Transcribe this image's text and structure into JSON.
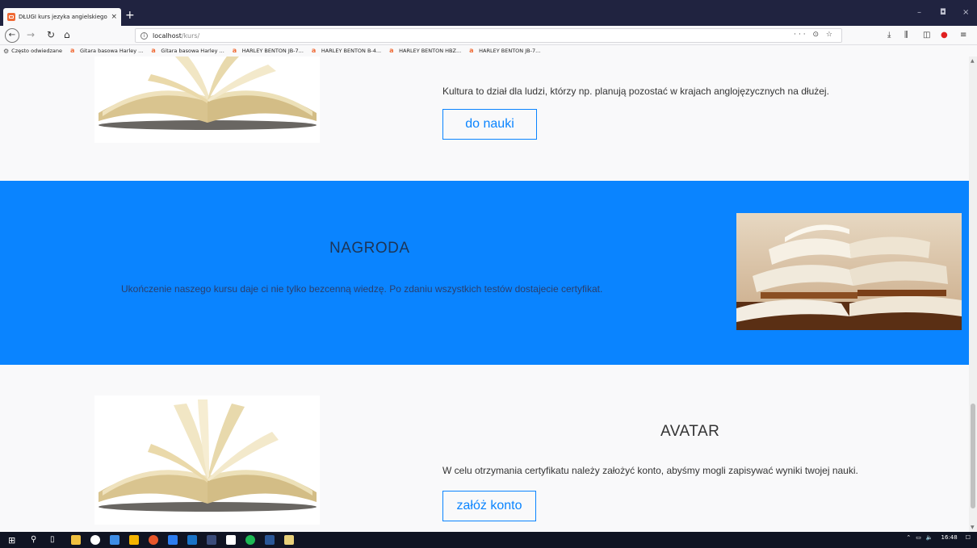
{
  "browser": {
    "tab_title": "DŁUGI kurs jezyka angielskiego",
    "tab_close": "×",
    "new_tab": "+",
    "url_host": "localhost",
    "url_path": "/kurs/",
    "url_actions": "··· ⊙ ☆",
    "window_controls": [
      "–",
      "◘",
      "×"
    ],
    "bookmarks": [
      {
        "label": "Często odwiedzane",
        "icon": "gear-icon"
      },
      {
        "label": "Gitara basowa Harley ...",
        "icon": "amazon-icon"
      },
      {
        "label": "Gitara basowa Harley ...",
        "icon": "amazon-icon"
      },
      {
        "label": "HARLEY BENTON JB-7...",
        "icon": "amazon-icon"
      },
      {
        "label": "HARLEY BENTON B-4...",
        "icon": "amazon-icon"
      },
      {
        "label": "HARLEY BENTON HBZ...",
        "icon": "amazon-icon"
      },
      {
        "label": "HARLEY BENTON JB-7...",
        "icon": "amazon-icon"
      }
    ]
  },
  "page": {
    "kultura": {
      "text": "Kultura to dział dla ludzi, którzy np. planują pozostać w krajach anglojęzycznych na dłużej.",
      "button": "do nauki"
    },
    "nagroda": {
      "title": "NAGRODA",
      "text": "Ukończenie naszego kursu daje ci nie tylko bezcenną wiedzę. Po zdaniu wszystkich testów dostajecie certyfikat."
    },
    "avatar": {
      "title": "AVATAR",
      "text": "W celu otrzymania certyfikatu należy założyć konto, abyśmy mogli zapisywać wyniki twojej nauki.",
      "button": "załóż konto"
    }
  },
  "taskbar": {
    "time": "16:48"
  },
  "colors": {
    "accent": "#0a84ff",
    "tabbar": "#202340",
    "taskbar": "#101423"
  }
}
